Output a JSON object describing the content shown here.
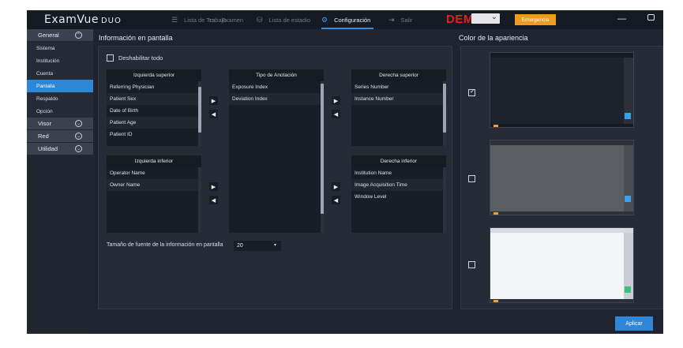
{
  "topbar": {
    "logo": "ExamVue",
    "logo_suffix": "DUO",
    "nav": [
      {
        "label": "Lista de Trabajo",
        "icon": "list-icon"
      },
      {
        "label": "Examen",
        "icon": "monitor-icon"
      },
      {
        "label": "Lista de estadio",
        "icon": "database-icon"
      },
      {
        "label": "Configuración",
        "icon": "gear-icon",
        "active": true
      },
      {
        "label": "Salir",
        "icon": "exit-icon"
      }
    ],
    "demo_label": "DEMO",
    "emergency_label": "Emergencia"
  },
  "sidebar": {
    "groups": [
      {
        "label": "General",
        "items": [
          "Sistema",
          "Institución",
          "Cuenta",
          "Pantalla",
          "Respaldo",
          "Opción"
        ],
        "active_item": "Pantalla"
      },
      {
        "label": "Visor"
      },
      {
        "label": "Red"
      },
      {
        "label": "Utilidad"
      }
    ]
  },
  "main": {
    "title": "Información en pantalla",
    "disable_all_label": "Deshabilitar todo",
    "lists": {
      "top_left": {
        "header": "Izquierda superior",
        "rows": [
          "Referring Physician",
          "Patient Sex",
          "Date of Birth",
          "Patient Age",
          "Patient ID"
        ]
      },
      "annotation": {
        "header": "Tipo de Anotación",
        "rows": [
          "Exposure Index",
          "Deviation Index"
        ]
      },
      "top_right": {
        "header": "Derecha superior",
        "rows": [
          "Series Number",
          "Instance Number"
        ]
      },
      "bottom_left": {
        "header": "Izquierda inferior",
        "rows": [
          "Operator Name",
          "Owner Name"
        ]
      },
      "bottom_right": {
        "header": "Derecha inferior",
        "rows": [
          "Institution Name",
          "Image Acquisition Time",
          "Window Level"
        ]
      }
    },
    "font_size_label": "Tamaño de fuente de la información en pantalla",
    "font_size_value": "20"
  },
  "appearance": {
    "title": "Color de la apariencia",
    "options": [
      {
        "theme": "dark",
        "checked": true
      },
      {
        "theme": "gray",
        "checked": false
      },
      {
        "theme": "light",
        "checked": false
      }
    ]
  },
  "apply_label": "Aplicar",
  "colors": {
    "accent": "#2e86d6",
    "demo": "#e21f1f",
    "emergency": "#f19a23",
    "background": "#1f2430"
  }
}
